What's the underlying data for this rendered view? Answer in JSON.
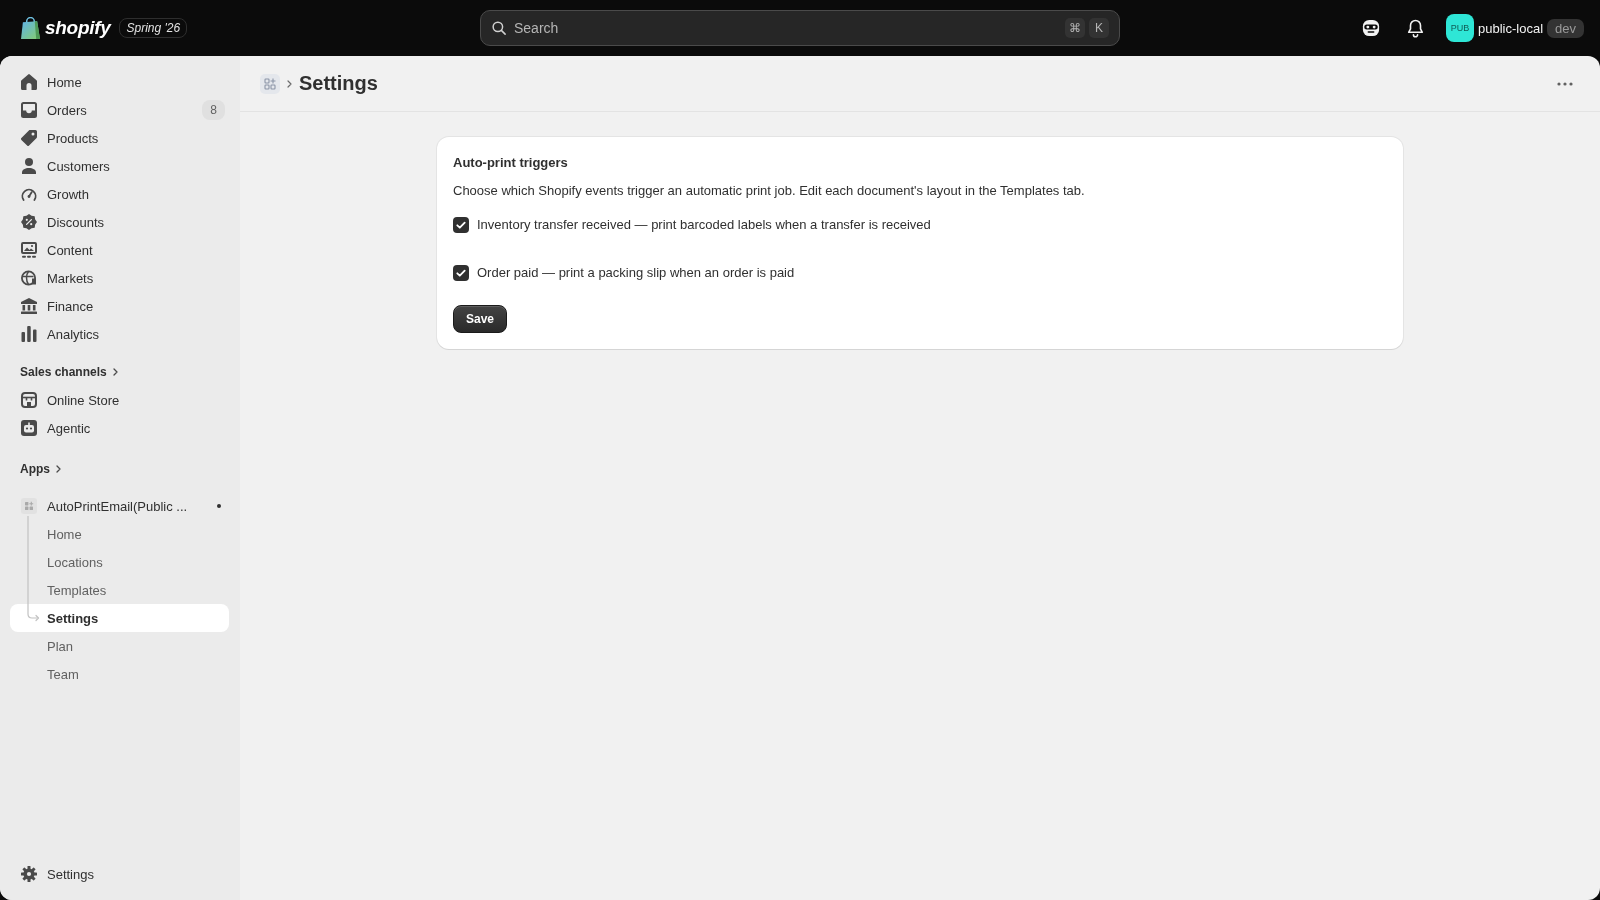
{
  "top_bar": {
    "logo_text": "shopify",
    "edition_badge": "Spring '26",
    "search": {
      "placeholder": "Search",
      "shortcut_keys": [
        "⌘",
        "K"
      ]
    },
    "store": {
      "avatar_initials": "PUB",
      "name": "public-local",
      "environment": "dev"
    }
  },
  "sidebar": {
    "items": [
      {
        "label": "Home",
        "selected": false
      },
      {
        "label": "Orders",
        "badge": "8",
        "selected": false
      },
      {
        "label": "Products",
        "selected": false
      },
      {
        "label": "Customers",
        "selected": false
      },
      {
        "label": "Growth",
        "selected": false
      },
      {
        "label": "Discounts",
        "selected": false
      },
      {
        "label": "Content",
        "selected": false
      },
      {
        "label": "Markets",
        "selected": false
      },
      {
        "label": "Finance",
        "selected": false
      },
      {
        "label": "Analytics",
        "selected": false
      }
    ],
    "sales_channels": {
      "heading": "Sales channels",
      "items": [
        {
          "label": "Online Store",
          "selected": false
        },
        {
          "label": "Agentic",
          "selected": false
        }
      ]
    },
    "apps": {
      "heading": "Apps",
      "items": [
        {
          "name": "AutoPrintEmail(Public ...",
          "selected": false,
          "expanded": true,
          "children": [
            {
              "label": "Home",
              "selected": false
            },
            {
              "label": "Locations",
              "selected": false
            },
            {
              "label": "Templates",
              "selected": false
            },
            {
              "label": "Settings",
              "selected": true
            },
            {
              "label": "Plan",
              "selected": false
            },
            {
              "label": "Team",
              "selected": false
            }
          ]
        }
      ]
    },
    "footer_item": {
      "label": "Settings",
      "selected": false
    }
  },
  "page": {
    "title": "Settings",
    "card": {
      "title": "Auto-print triggers",
      "description": "Choose which Shopify events trigger an automatic print job. Edit each document's layout in the Templates tab.",
      "options": [
        {
          "label": "Inventory transfer received — print barcoded labels when a transfer is received",
          "checked": true
        },
        {
          "label": "Order paid — print a packing slip when an order is paid",
          "checked": true
        }
      ],
      "save_button": "Save"
    }
  }
}
